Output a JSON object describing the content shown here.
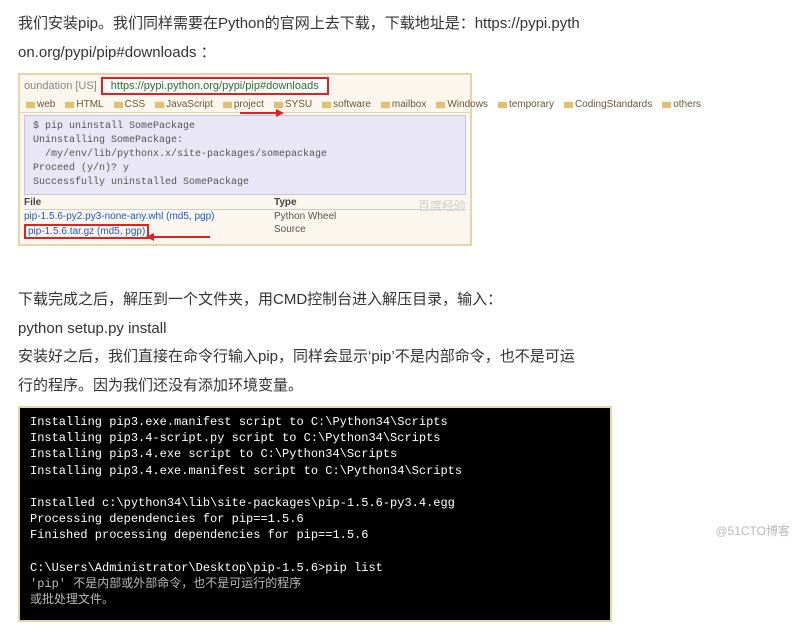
{
  "intro": {
    "line1": "我们安装pip。我们同样需要在Python的官网上去下载，下载地址是：https://pypi.pyth",
    "line2": "on.org/pypi/pip#downloads ："
  },
  "browser": {
    "addr_left": "oundation [US]",
    "url": "https://pypi.python.org/pypi/pip#downloads",
    "bookmarks": [
      "web",
      "HTML",
      "CSS",
      "JavaScript",
      "project",
      "SYSU",
      "software",
      "mailbox",
      "Windows",
      "temporary",
      "CodingStandards",
      "others"
    ]
  },
  "terminal": "$ pip uninstall SomePackage\nUninstalling SomePackage:\n  /my/env/lib/pythonx.x/site-packages/somepackage\nProceed (y/n)? y\nSuccessfully uninstalled SomePackage",
  "files": {
    "head1": "File",
    "head2": "Type",
    "row1_name": "pip-1.5.6-py2.py3-none-any.whl (md5, pgp)",
    "row1_type": "Python Wheel",
    "row2_name": "pip-1.5.6.tar.gz (md5, pgp)",
    "row2_type": "Source"
  },
  "watermark": "百度经验",
  "mid": {
    "l1": "下载完成之后，解压到一个文件夹，用CMD控制台进入解压目录，输入：",
    "l2": "python setup.py install",
    "l3": "安装好之后，我们直接在命令行输入pip，同样会显示‘pip’不是内部命令，也不是可运",
    "l4": "行的程序。因为我们还没有添加环境变量。"
  },
  "cmd": {
    "l0": "Installing pip3.exe.manifest script to C:\\Python34\\Scripts",
    "l1": "Installing pip3.4-script.py script to C:\\Python34\\Scripts",
    "l2": "Installing pip3.4.exe script to C:\\Python34\\Scripts",
    "l3": "Installing pip3.4.exe.manifest script to C:\\Python34\\Scripts",
    "l4": "",
    "l5": "Installed c:\\python34\\lib\\site-packages\\pip-1.5.6-py3.4.egg",
    "l6": "Processing dependencies for pip==1.5.6",
    "l7": "Finished processing dependencies for pip==1.5.6",
    "l8": "",
    "l9": "C:\\Users\\Administrator\\Desktop\\pip-1.5.6>pip list",
    "l10": "'pip' 不是内部或外部命令，也不是可运行的程序",
    "l11": "或批处理文件。"
  },
  "footer": "@51CTO博客"
}
